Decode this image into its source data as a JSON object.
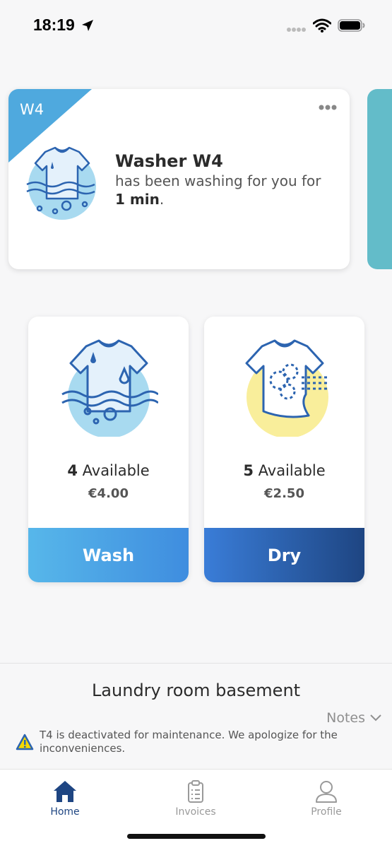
{
  "status_bar": {
    "time": "18:19"
  },
  "active_session": {
    "badge": "W4",
    "title": "Washer W4",
    "subtitle": "has been washing for you for",
    "duration": "1 min",
    "period": "."
  },
  "machines": [
    {
      "type": "wash",
      "count": "4",
      "available_label": "Available",
      "price": "€4.00",
      "button_label": "Wash",
      "icon": "washing-shirt-icon"
    },
    {
      "type": "dry",
      "count": "5",
      "available_label": "Available",
      "price": "€2.50",
      "button_label": "Dry",
      "icon": "drying-shirt-icon"
    }
  ],
  "room": {
    "title": "Laundry room basement",
    "notes_label": "Notes",
    "notice": "T4 is deactivated for maintenance. We apologize for the inconveniences."
  },
  "tabs": [
    {
      "label": "Home",
      "icon": "home-icon",
      "active": true
    },
    {
      "label": "Invoices",
      "icon": "invoices-icon",
      "active": false
    },
    {
      "label": "Profile",
      "icon": "profile-icon",
      "active": false
    }
  ],
  "colors": {
    "brand_dark": "#1e4582",
    "wash_gradient_start": "#57b7ea",
    "wash_gradient_end": "#3f8ddf",
    "dry_gradient_start": "#3a7dd8",
    "dry_gradient_end": "#1e4582",
    "ribbon": "#4fa9de",
    "next_card": "#63bcc9"
  }
}
